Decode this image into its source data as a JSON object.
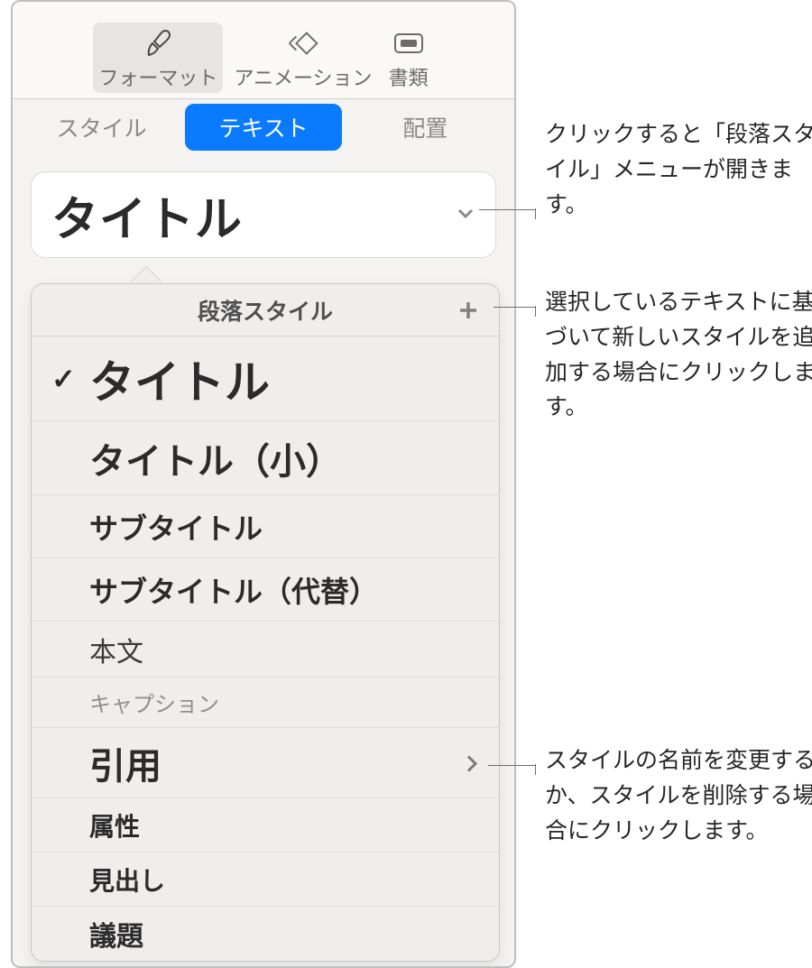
{
  "toolbar": {
    "format": "フォーマット",
    "animation": "アニメーション",
    "document": "書類"
  },
  "subtabs": {
    "style": "スタイル",
    "text": "テキスト",
    "arrange": "配置"
  },
  "current_style": "タイトル",
  "popover": {
    "title": "段落スタイル",
    "items": [
      {
        "label": "タイトル",
        "class": "s-title",
        "selected": true
      },
      {
        "label": "タイトル（小）",
        "class": "s-title-sm"
      },
      {
        "label": "サブタイトル",
        "class": "s-subtitle"
      },
      {
        "label": "サブタイトル（代替）",
        "class": "s-subtitle-alt"
      },
      {
        "label": "本文",
        "class": "s-body"
      },
      {
        "label": "キャプション",
        "class": "s-caption"
      },
      {
        "label": "引用",
        "class": "s-quote",
        "chevron": true
      },
      {
        "label": "属性",
        "class": "s-attrib"
      },
      {
        "label": "見出し",
        "class": "s-heading"
      },
      {
        "label": "議題",
        "class": "s-agenda"
      }
    ]
  },
  "callouts": {
    "open_menu": "クリックすると「段落スタイル」メニューが開きます。",
    "add_style": "選択しているテキストに基づいて新しいスタイルを追加する場合にクリックします。",
    "rename_delete": "スタイルの名前を変更するか、スタイルを削除する場合にクリックします。"
  }
}
